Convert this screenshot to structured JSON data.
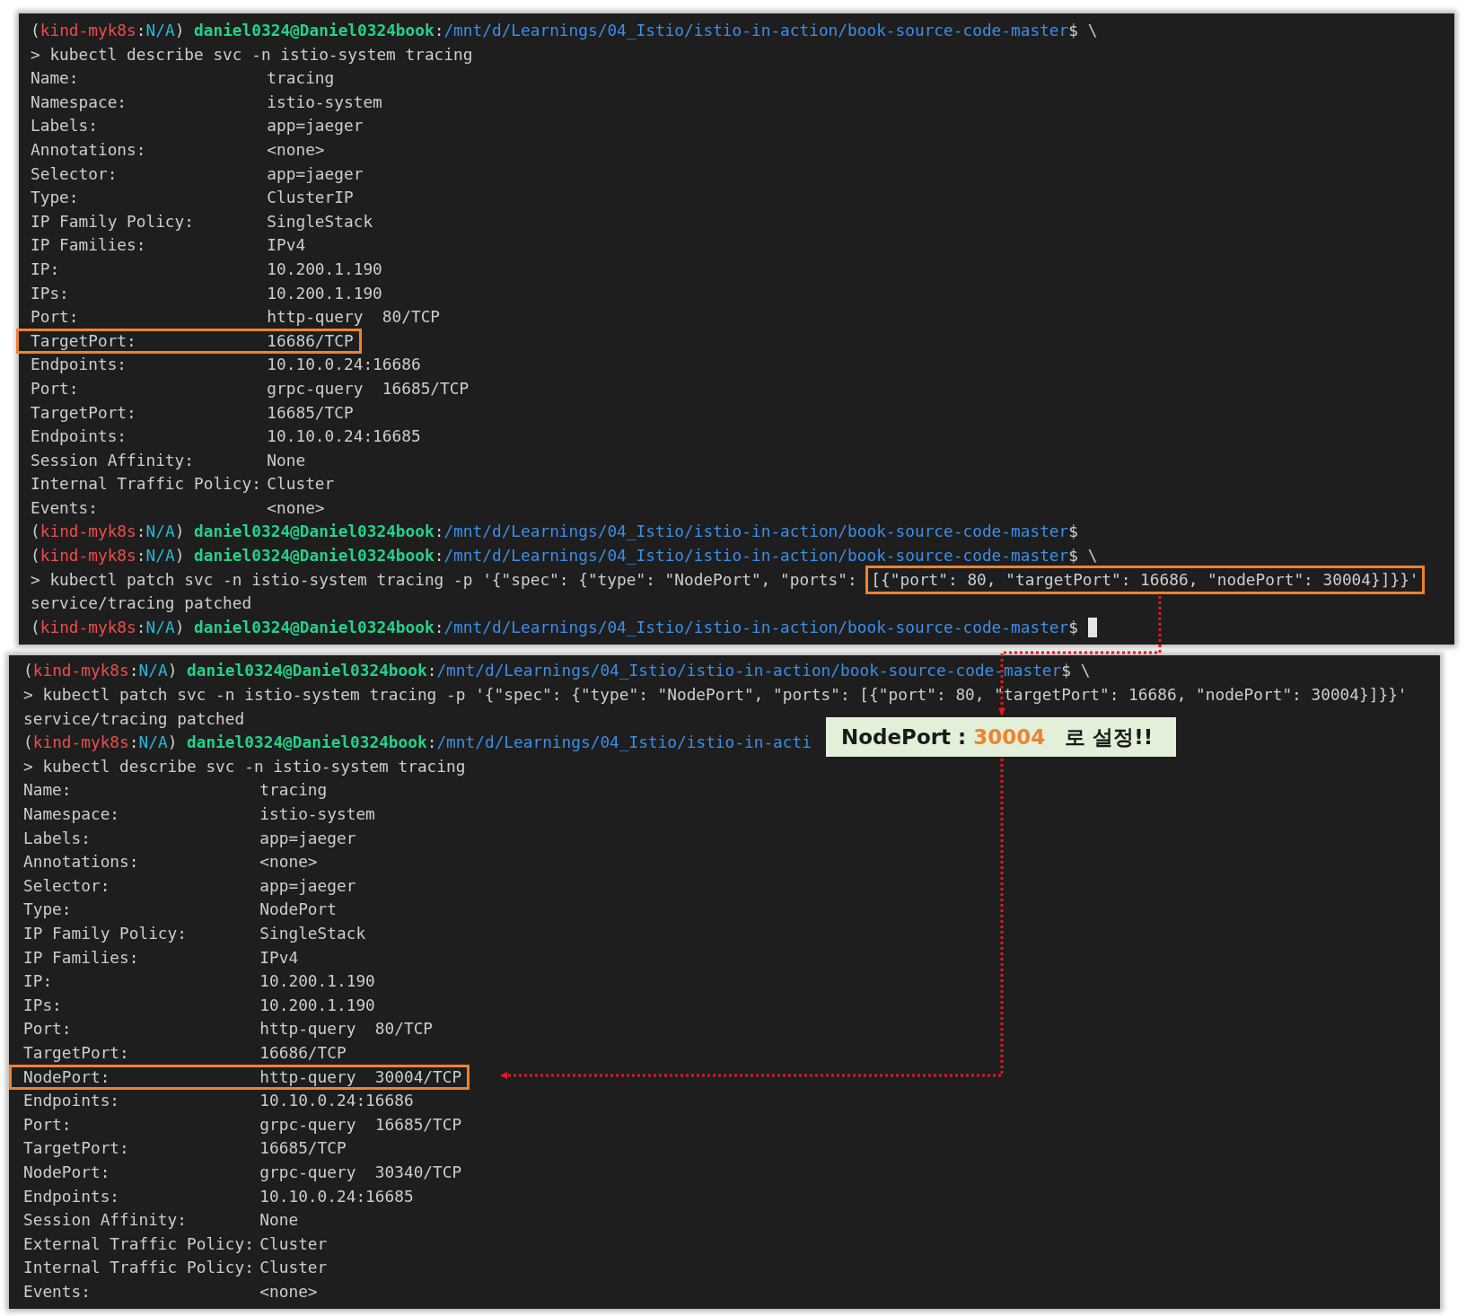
{
  "terminals": [
    {
      "lines": [
        {
          "kind": "prompt",
          "cursor": false,
          "segments": [
            {
              "kind": "plain",
              "text": "("
            },
            {
              "kind": "context",
              "text": "kind-myk8s"
            },
            {
              "kind": "plain",
              "text": ":"
            },
            {
              "kind": "namespace",
              "text": "N/A"
            },
            {
              "kind": "plain",
              "text": ") "
            },
            {
              "kind": "user",
              "text": "daniel0324@Daniel0324book"
            },
            {
              "kind": "plain",
              "text": ":"
            },
            {
              "kind": "path",
              "text": "/mnt/d/Learnings/04_Istio/istio-in-action/book-source-code-master"
            },
            {
              "kind": "plain",
              "text": "$ \\"
            }
          ]
        },
        {
          "kind": "command",
          "text": "> kubectl describe svc -n istio-system tracing"
        },
        {
          "kind": "field",
          "label": "Name:",
          "value": "tracing",
          "highlighted": false
        },
        {
          "kind": "field",
          "label": "Namespace:",
          "value": "istio-system",
          "highlighted": false
        },
        {
          "kind": "field",
          "label": "Labels:",
          "value": "app=jaeger",
          "highlighted": false
        },
        {
          "kind": "field",
          "label": "Annotations:",
          "value": "<none>",
          "highlighted": false
        },
        {
          "kind": "field",
          "label": "Selector:",
          "value": "app=jaeger",
          "highlighted": false
        },
        {
          "kind": "field",
          "label": "Type:",
          "value": "ClusterIP",
          "highlighted": false
        },
        {
          "kind": "field",
          "label": "IP Family Policy:",
          "value": "SingleStack",
          "highlighted": false
        },
        {
          "kind": "field",
          "label": "IP Families:",
          "value": "IPv4",
          "highlighted": false
        },
        {
          "kind": "field",
          "label": "IP:",
          "value": "10.200.1.190",
          "highlighted": false
        },
        {
          "kind": "field",
          "label": "IPs:",
          "value": "10.200.1.190",
          "highlighted": false
        },
        {
          "kind": "field",
          "label": "Port:",
          "value": "http-query  80/TCP",
          "highlighted": false
        },
        {
          "kind": "field",
          "label": "TargetPort:",
          "value": "16686/TCP",
          "highlighted": true
        },
        {
          "kind": "field",
          "label": "Endpoints:",
          "value": "10.10.0.24:16686",
          "highlighted": false
        },
        {
          "kind": "field",
          "label": "Port:",
          "value": "grpc-query  16685/TCP",
          "highlighted": false
        },
        {
          "kind": "field",
          "label": "TargetPort:",
          "value": "16685/TCP",
          "highlighted": false
        },
        {
          "kind": "field",
          "label": "Endpoints:",
          "value": "10.10.0.24:16685",
          "highlighted": false
        },
        {
          "kind": "field",
          "label": "Session Affinity:",
          "value": "None",
          "highlighted": false
        },
        {
          "kind": "field",
          "label": "Internal Traffic Policy:",
          "value": "Cluster",
          "highlighted": false
        },
        {
          "kind": "field",
          "label": "Events:",
          "value": "<none>",
          "highlighted": false
        },
        {
          "kind": "prompt",
          "cursor": false,
          "segments": [
            {
              "kind": "plain",
              "text": "("
            },
            {
              "kind": "context",
              "text": "kind-myk8s"
            },
            {
              "kind": "plain",
              "text": ":"
            },
            {
              "kind": "namespace",
              "text": "N/A"
            },
            {
              "kind": "plain",
              "text": ") "
            },
            {
              "kind": "user",
              "text": "daniel0324@Daniel0324book"
            },
            {
              "kind": "plain",
              "text": ":"
            },
            {
              "kind": "path",
              "text": "/mnt/d/Learnings/04_Istio/istio-in-action/book-source-code-master"
            },
            {
              "kind": "plain",
              "text": "$"
            }
          ]
        },
        {
          "kind": "prompt",
          "cursor": false,
          "segments": [
            {
              "kind": "plain",
              "text": "("
            },
            {
              "kind": "context",
              "text": "kind-myk8s"
            },
            {
              "kind": "plain",
              "text": ":"
            },
            {
              "kind": "namespace",
              "text": "N/A"
            },
            {
              "kind": "plain",
              "text": ") "
            },
            {
              "kind": "user",
              "text": "daniel0324@Daniel0324book"
            },
            {
              "kind": "plain",
              "text": ":"
            },
            {
              "kind": "path",
              "text": "/mnt/d/Learnings/04_Istio/istio-in-action/book-source-code-master"
            },
            {
              "kind": "plain",
              "text": "$ \\"
            }
          ]
        },
        {
          "kind": "command",
          "text": "> kubectl patch svc -n istio-system tracing -p '{\"spec\": {\"type\": \"NodePort\", \"ports\": ",
          "highlight": "[{\"port\": 80, \"targetPort\": 16686, \"nodePort\": 30004}]}}'"
        },
        {
          "kind": "output",
          "text": "service/tracing patched"
        },
        {
          "kind": "prompt",
          "cursor": true,
          "segments": [
            {
              "kind": "plain",
              "text": "("
            },
            {
              "kind": "context",
              "text": "kind-myk8s"
            },
            {
              "kind": "plain",
              "text": ":"
            },
            {
              "kind": "namespace",
              "text": "N/A"
            },
            {
              "kind": "plain",
              "text": ") "
            },
            {
              "kind": "user",
              "text": "daniel0324@Daniel0324book"
            },
            {
              "kind": "plain",
              "text": ":"
            },
            {
              "kind": "path",
              "text": "/mnt/d/Learnings/04_Istio/istio-in-action/book-source-code-master"
            },
            {
              "kind": "plain",
              "text": "$"
            }
          ]
        }
      ]
    },
    {
      "lines": [
        {
          "kind": "prompt",
          "cursor": false,
          "segments": [
            {
              "kind": "plain",
              "text": "("
            },
            {
              "kind": "context",
              "text": "kind-myk8s"
            },
            {
              "kind": "plain",
              "text": ":"
            },
            {
              "kind": "namespace",
              "text": "N/A"
            },
            {
              "kind": "plain",
              "text": ") "
            },
            {
              "kind": "user",
              "text": "daniel0324@Daniel0324book"
            },
            {
              "kind": "plain",
              "text": ":"
            },
            {
              "kind": "path",
              "text": "/mnt/d/Learnings/04_Istio/istio-in-action/book-source-code-master"
            },
            {
              "kind": "plain",
              "text": "$ \\"
            }
          ]
        },
        {
          "kind": "command",
          "text": "> kubectl patch svc -n istio-system tracing -p '{\"spec\": {\"type\": \"NodePort\", \"ports\": [{\"port\": 80, \"targetPort\": 16686, \"nodePort\": 30004}]}}'"
        },
        {
          "kind": "output",
          "text": "service/tracing patched"
        },
        {
          "kind": "prompt",
          "cursor": false,
          "segments": [
            {
              "kind": "plain",
              "text": "("
            },
            {
              "kind": "context",
              "text": "kind-myk8s"
            },
            {
              "kind": "plain",
              "text": ":"
            },
            {
              "kind": "namespace",
              "text": "N/A"
            },
            {
              "kind": "plain",
              "text": ") "
            },
            {
              "kind": "user",
              "text": "daniel0324@Daniel0324book"
            },
            {
              "kind": "plain",
              "text": ":"
            },
            {
              "kind": "path",
              "text": "/mnt/d/Learnings/04_Istio/istio-in-acti"
            }
          ]
        },
        {
          "kind": "command",
          "text": "> kubectl describe svc -n istio-system tracing"
        },
        {
          "kind": "field",
          "label": "Name:",
          "value": "tracing",
          "highlighted": false
        },
        {
          "kind": "field",
          "label": "Namespace:",
          "value": "istio-system",
          "highlighted": false
        },
        {
          "kind": "field",
          "label": "Labels:",
          "value": "app=jaeger",
          "highlighted": false
        },
        {
          "kind": "field",
          "label": "Annotations:",
          "value": "<none>",
          "highlighted": false
        },
        {
          "kind": "field",
          "label": "Selector:",
          "value": "app=jaeger",
          "highlighted": false
        },
        {
          "kind": "field",
          "label": "Type:",
          "value": "NodePort",
          "highlighted": false
        },
        {
          "kind": "field",
          "label": "IP Family Policy:",
          "value": "SingleStack",
          "highlighted": false
        },
        {
          "kind": "field",
          "label": "IP Families:",
          "value": "IPv4",
          "highlighted": false
        },
        {
          "kind": "field",
          "label": "IP:",
          "value": "10.200.1.190",
          "highlighted": false
        },
        {
          "kind": "field",
          "label": "IPs:",
          "value": "10.200.1.190",
          "highlighted": false
        },
        {
          "kind": "field",
          "label": "Port:",
          "value": "http-query  80/TCP",
          "highlighted": false
        },
        {
          "kind": "field",
          "label": "TargetPort:",
          "value": "16686/TCP",
          "highlighted": false
        },
        {
          "kind": "field",
          "label": "NodePort:",
          "value": "http-query  30004/TCP",
          "highlighted": true
        },
        {
          "kind": "field",
          "label": "Endpoints:",
          "value": "10.10.0.24:16686",
          "highlighted": false
        },
        {
          "kind": "field",
          "label": "Port:",
          "value": "grpc-query  16685/TCP",
          "highlighted": false
        },
        {
          "kind": "field",
          "label": "TargetPort:",
          "value": "16685/TCP",
          "highlighted": false
        },
        {
          "kind": "field",
          "label": "NodePort:",
          "value": "grpc-query  30340/TCP",
          "highlighted": false
        },
        {
          "kind": "field",
          "label": "Endpoints:",
          "value": "10.10.0.24:16685",
          "highlighted": false
        },
        {
          "kind": "field",
          "label": "Session Affinity:",
          "value": "None",
          "highlighted": false
        },
        {
          "kind": "field",
          "label": "External Traffic Policy:",
          "value": "Cluster",
          "highlighted": false
        },
        {
          "kind": "field",
          "label": "Internal Traffic Policy:",
          "value": "Cluster",
          "highlighted": false
        },
        {
          "kind": "field",
          "label": "Events:",
          "value": "<none>",
          "highlighted": false
        }
      ]
    }
  ],
  "callout": {
    "label": "NodePort : ",
    "value": "30004",
    "note": "로 설정!!"
  }
}
